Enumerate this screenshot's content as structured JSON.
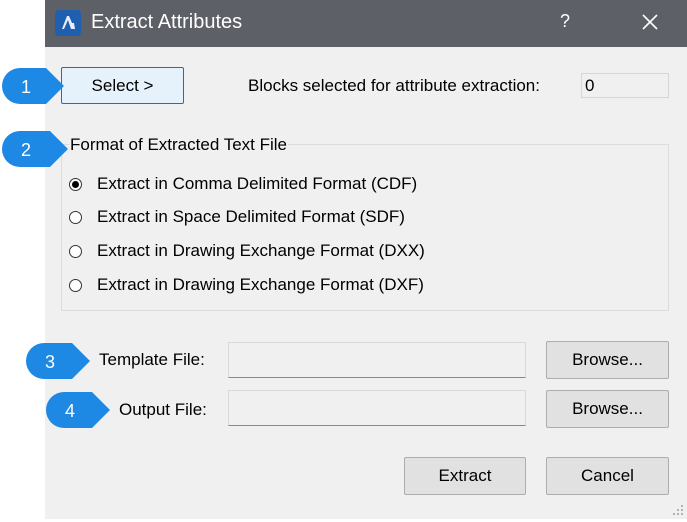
{
  "window": {
    "title": "Extract Attributes",
    "help": "?"
  },
  "select_button": "Select >",
  "blocks_label": "Blocks selected for attribute extraction:",
  "blocks_count": "0",
  "format_group": {
    "title": "Format of Extracted Text File",
    "options": [
      {
        "label": "Extract in Comma Delimited Format (CDF)",
        "checked": true
      },
      {
        "label": "Extract in Space Delimited Format (SDF)",
        "checked": false
      },
      {
        "label": "Extract in Drawing Exchange Format (DXX)",
        "checked": false
      },
      {
        "label": "Extract in Drawing Exchange Format (DXF)",
        "checked": false
      }
    ]
  },
  "template": {
    "label": "Template File:",
    "value": "",
    "browse": "Browse..."
  },
  "output": {
    "label": "Output File:",
    "value": "",
    "browse": "Browse..."
  },
  "buttons": {
    "extract": "Extract",
    "cancel": "Cancel"
  },
  "callouts": [
    "1",
    "2",
    "3",
    "4"
  ],
  "colors": {
    "titlebar": "#5d6066",
    "dialog": "#f0f0f0",
    "callout": "#1e88e5",
    "app_icon": "#1f5fb0"
  }
}
